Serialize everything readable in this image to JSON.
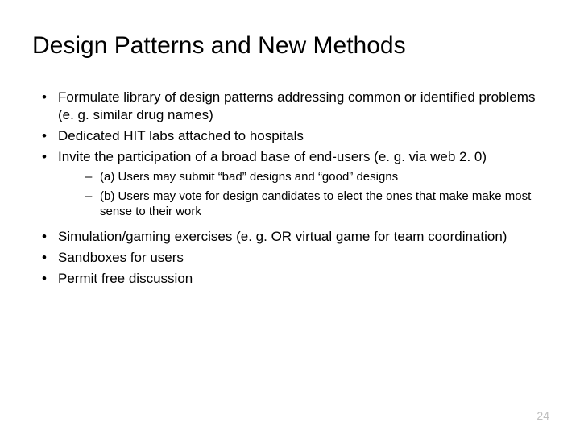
{
  "title": "Design Patterns and New Methods",
  "bullets1": {
    "b0": "Formulate library of design patterns addressing common or identified problems (e. g. similar drug names)",
    "b1": "Dedicated HIT labs attached to hospitals",
    "b2": "Invite the participation of a broad base of end-users (e. g. via web 2. 0)"
  },
  "sub": {
    "s0": "(a)  Users may submit “bad” designs and “good” designs",
    "s1": "(b) Users may vote for design candidates to elect the ones that make make most sense to their work"
  },
  "bullets2": {
    "b0": "Simulation/gaming exercises (e. g. OR virtual game for team coordination)",
    "b1": "Sandboxes for users",
    "b2": "Permit free discussion"
  },
  "page": "24"
}
